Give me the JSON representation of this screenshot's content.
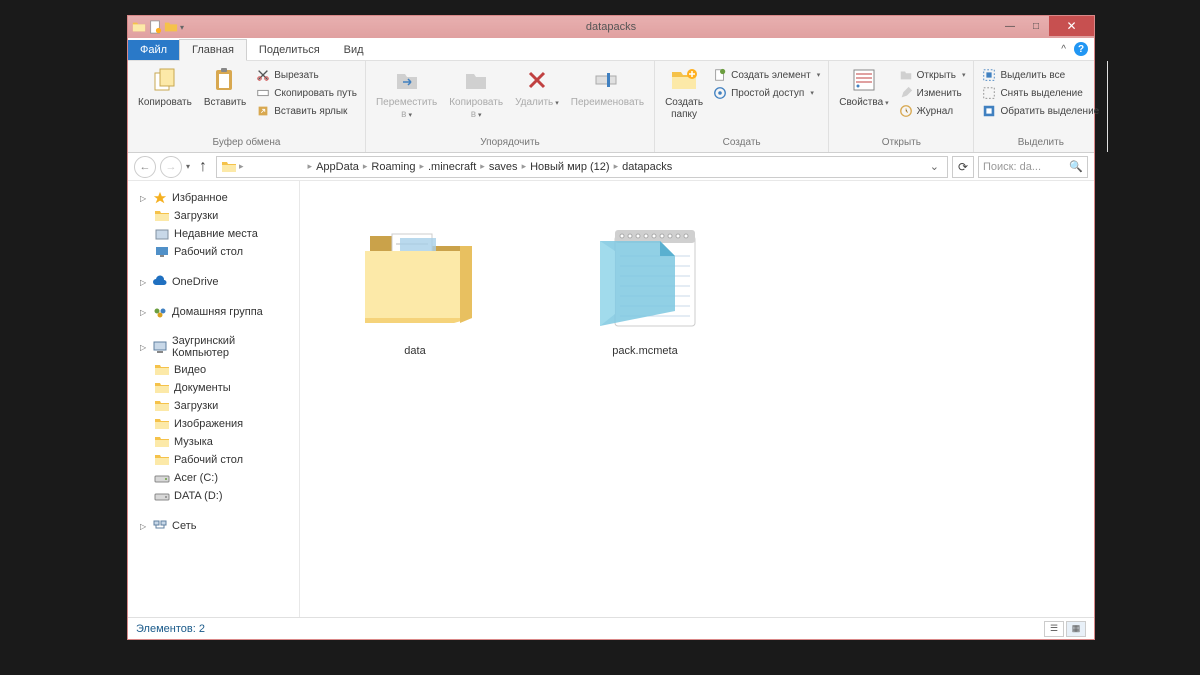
{
  "title": "datapacks",
  "tabs": {
    "file": "Файл",
    "home": "Главная",
    "share": "Поделиться",
    "view": "Вид"
  },
  "ribbon": {
    "clipboard": {
      "label": "Буфер обмена",
      "copy": "Копировать",
      "paste": "Вставить",
      "cut": "Вырезать",
      "copy_path": "Скопировать путь",
      "paste_shortcut": "Вставить ярлык"
    },
    "organize": {
      "label": "Упорядочить",
      "move_to": "Переместить в",
      "copy_to": "Копировать в",
      "delete": "Удалить",
      "rename": "Переименовать"
    },
    "new": {
      "label": "Создать",
      "new_folder": "Создать папку",
      "new_item": "Создать элемент",
      "easy_access": "Простой доступ"
    },
    "open": {
      "label": "Открыть",
      "properties": "Свойства",
      "open": "Открыть",
      "edit": "Изменить",
      "history": "Журнал"
    },
    "select": {
      "label": "Выделить",
      "select_all": "Выделить все",
      "select_none": "Снять выделение",
      "invert": "Обратить выделение"
    }
  },
  "breadcrumb": [
    "AppData",
    "Roaming",
    ".minecraft",
    "saves",
    "Новый мир (12)",
    "datapacks"
  ],
  "search_placeholder": "Поиск: da...",
  "sidebar": {
    "favorites": {
      "label": "Избранное",
      "items": [
        "Загрузки",
        "Недавние места",
        "Рабочий стол"
      ]
    },
    "onedrive": "OneDrive",
    "homegroup": "Домашняя группа",
    "computer": {
      "label": "Заугринский Компьютер",
      "items": [
        "Видео",
        "Документы",
        "Загрузки",
        "Изображения",
        "Музыка",
        "Рабочий стол",
        "Acer (C:)",
        "DATA (D:)"
      ]
    },
    "network": "Сеть"
  },
  "files": {
    "folder": "data",
    "file": "pack.mcmeta"
  },
  "status": "Элементов: 2"
}
